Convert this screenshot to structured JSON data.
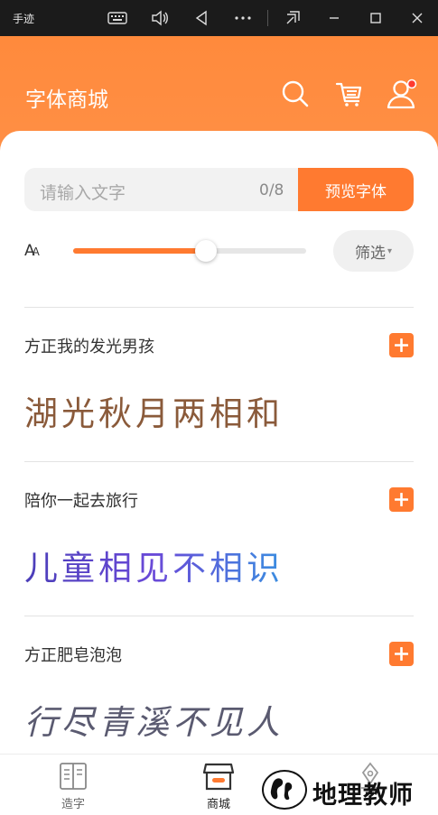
{
  "window": {
    "app_title": "手迹",
    "keyboard_icon": "keyboard-icon",
    "volume_icon": "volume-icon",
    "back_icon": "back-triangle-icon",
    "more_icon": "more-dots-icon"
  },
  "header": {
    "title": "字体商城",
    "accent": "#ff8a3c",
    "badge_color": "#ff3b30"
  },
  "search": {
    "placeholder": "请输入文字",
    "counter": "0/8",
    "preview_button": "预览字体"
  },
  "size_control": {
    "label_big": "A",
    "label_small": "A",
    "value_fraction": 0.57
  },
  "filter": {
    "label": "筛选",
    "caret": "▾"
  },
  "fonts": [
    {
      "name": "方正我的发光男孩",
      "sample": "湖光秋月两相和"
    },
    {
      "name": "陪你一起去旅行",
      "sample": "儿童相见不相识"
    },
    {
      "name": "方正肥皂泡泡",
      "sample": "行尽青溪不见人"
    }
  ],
  "nav": {
    "items": [
      {
        "label": "造字",
        "icon": "book-icon"
      },
      {
        "label": "商城",
        "icon": "store-icon"
      },
      {
        "label": "",
        "icon": "pen-icon"
      }
    ]
  },
  "watermark": {
    "text": "地理教师"
  }
}
